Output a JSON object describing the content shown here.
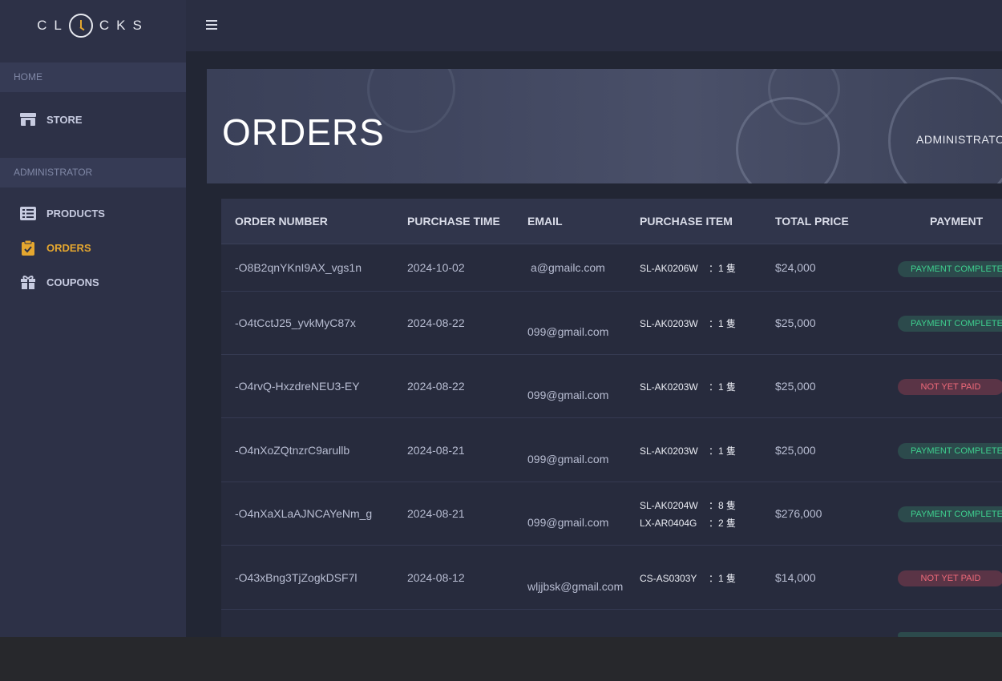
{
  "brand": {
    "left": "CL",
    "right": "CKS"
  },
  "sidebar": {
    "home_head": "HOME",
    "store": "STORE",
    "admin_head": "ADMINISTRATOR",
    "products": "PRODUCTS",
    "orders": "ORDERS",
    "coupons": "COUPONS"
  },
  "banner": {
    "title": "ORDERS",
    "role": "ADMINISTRATOR"
  },
  "table": {
    "headers": {
      "order_number": "ORDER NUMBER",
      "purchase_time": "PURCHASE TIME",
      "email": "EMAIL",
      "purchase_item": "PURCHASE ITEM",
      "total_price": "TOTAL PRICE",
      "payment": "PAYMENT"
    },
    "rows": [
      {
        "id": "-O8B2qnYKnI9AX_vgs1n",
        "time": "2024-10-02",
        "email": "a@gmailc.com",
        "items": [
          {
            "code": "SL-AK0206W",
            "qty": "：1 隻"
          }
        ],
        "price": "$24,000",
        "payment": "PAYMENT COMPLETED",
        "paid": true
      },
      {
        "id": "-O4tCctJ25_yvkMyC87x",
        "time": "2024-08-22",
        "email": "099@gmail.com",
        "items": [
          {
            "code": "SL-AK0203W",
            "qty": "：1 隻"
          }
        ],
        "price": "$25,000",
        "payment": "PAYMENT COMPLETED",
        "paid": true
      },
      {
        "id": "-O4rvQ-HxzdreNEU3-EY",
        "time": "2024-08-22",
        "email": "099@gmail.com",
        "items": [
          {
            "code": "SL-AK0203W",
            "qty": "：1 隻"
          }
        ],
        "price": "$25,000",
        "payment": "NOT YET PAID",
        "paid": false
      },
      {
        "id": "-O4nXoZQtnzrC9arullb",
        "time": "2024-08-21",
        "email": "099@gmail.com",
        "items": [
          {
            "code": "SL-AK0203W",
            "qty": "：1 隻"
          }
        ],
        "price": "$25,000",
        "payment": "PAYMENT COMPLETED",
        "paid": true
      },
      {
        "id": "-O4nXaXLaAJNCAYeNm_g",
        "time": "2024-08-21",
        "email": "099@gmail.com",
        "items": [
          {
            "code": "SL-AK0204W",
            "qty": "：8 隻"
          },
          {
            "code": "LX-AR0404G",
            "qty": "：2 隻"
          }
        ],
        "price": "$276,000",
        "payment": "PAYMENT COMPLETED",
        "paid": true
      },
      {
        "id": "-O43xBng3TjZogkDSF7l",
        "time": "2024-08-12",
        "email": "wljjbsk@gmail.com",
        "items": [
          {
            "code": "CS-AS0303Y",
            "qty": "：1 隻"
          }
        ],
        "price": "$14,000",
        "payment": "NOT YET PAID",
        "paid": false
      }
    ]
  },
  "colors": {
    "accent": "#e5a72f",
    "paid": "#3ecf8e",
    "unpaid": "#f06a7a"
  }
}
